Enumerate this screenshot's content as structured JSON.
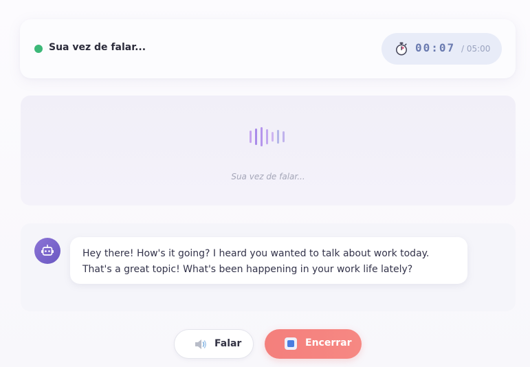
{
  "status": {
    "label": "Sua vez de falar...",
    "indicator_color": "#3cb878"
  },
  "timer": {
    "icon": "stopwatch-icon",
    "elapsed": "00:07",
    "total": "/ 05:00"
  },
  "visualizer": {
    "icon": "audio-wave-icon",
    "hint": "Sua vez de falar..."
  },
  "chat": {
    "avatar_icon": "robot-icon",
    "message": "Hey there! How's it going? I heard you wanted to talk about work today. That's a great topic! What's been happening in your work life lately?"
  },
  "controls": {
    "speak_label": "Falar",
    "speak_icon": "speaker-icon",
    "end_label": "Encerrar",
    "end_icon": "stop-icon",
    "end_color": "#f47f7c"
  }
}
